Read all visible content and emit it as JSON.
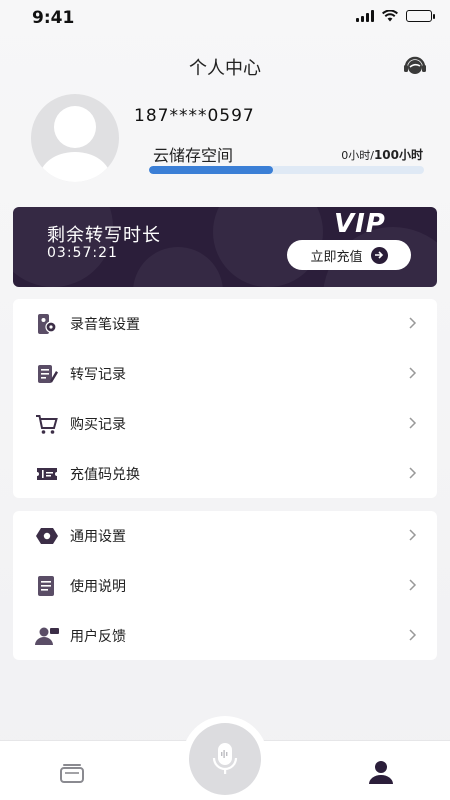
{
  "status_bar": {
    "time": "9:41"
  },
  "header": {
    "title": "个人中心"
  },
  "profile": {
    "phone": "187****0597",
    "storage_label": "云储存空间",
    "storage_used": "0小时",
    "storage_separator": "/",
    "storage_total": "100小时",
    "storage_fraction": 0.45
  },
  "vip_card": {
    "title": "剩余转写时长",
    "remaining_time": "03:57:21",
    "badge": "VIP",
    "recharge_label": "立即充值"
  },
  "menu_group_1": [
    {
      "label": "录音笔设置",
      "icon": "recorder-settings-icon"
    },
    {
      "label": "转写记录",
      "icon": "transcribe-record-icon"
    },
    {
      "label": "购买记录",
      "icon": "cart-icon"
    },
    {
      "label": "充值码兑换",
      "icon": "ticket-icon"
    }
  ],
  "menu_group_2": [
    {
      "label": "通用设置",
      "icon": "hexagon-settings-icon"
    },
    {
      "label": "使用说明",
      "icon": "document-icon"
    },
    {
      "label": "用户反馈",
      "icon": "feedback-user-icon"
    }
  ],
  "tab_bar": {
    "items": [
      "files-tab-icon",
      "record-mic-icon",
      "profile-tab-icon"
    ],
    "active": "profile"
  },
  "colors": {
    "accent_blue": "#3b7fd6",
    "vip_bg": "#2b1e3a",
    "icon_dark": "#3c2e47"
  }
}
